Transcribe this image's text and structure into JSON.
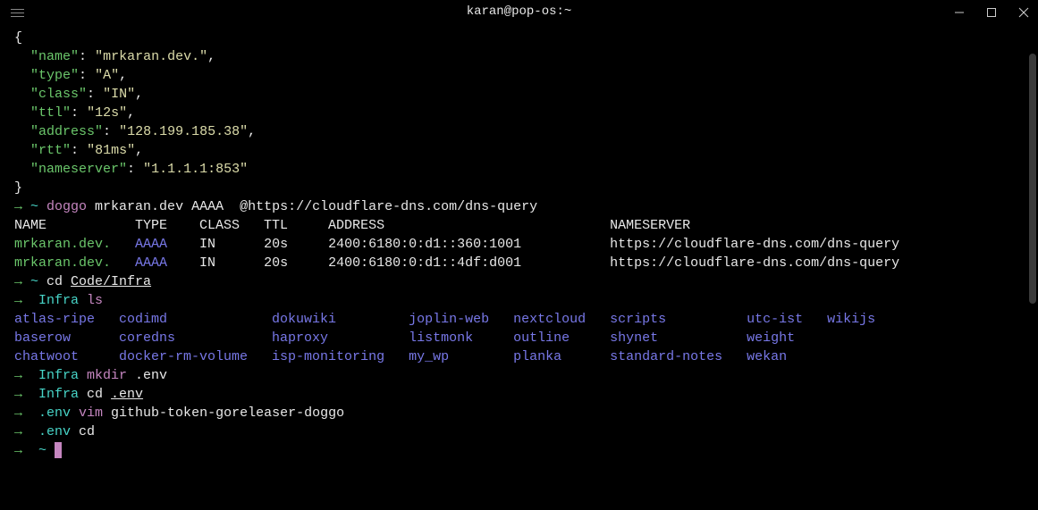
{
  "window": {
    "title": "karan@pop-os:~"
  },
  "json_output": {
    "open_brace": "{",
    "close_brace": "}",
    "fields": [
      {
        "key": "\"name\"",
        "colon": ":",
        "space": " ",
        "value": "\"mrkaran.dev.\"",
        "comma": ","
      },
      {
        "key": "\"type\"",
        "colon": ":",
        "space": " ",
        "value": "\"A\"",
        "comma": ","
      },
      {
        "key": "\"class\"",
        "colon": ":",
        "space": " ",
        "value": "\"IN\"",
        "comma": ","
      },
      {
        "key": "\"ttl\"",
        "colon": ":",
        "space": " ",
        "value": "\"12s\"",
        "comma": ","
      },
      {
        "key": "\"address\"",
        "colon": ":",
        "space": " ",
        "value": "\"128.199.185.38\"",
        "comma": ","
      },
      {
        "key": "\"rtt\"",
        "colon": ":",
        "space": " ",
        "value": "\"81ms\"",
        "comma": ","
      },
      {
        "key": "\"nameserver\"",
        "colon": ":",
        "space": " ",
        "value": "\"1.1.1.1:853\"",
        "comma": ""
      }
    ]
  },
  "doggo_cmd": {
    "arrow": "→",
    "tilde": " ~",
    "cmd": " doggo",
    "args": " mrkaran.dev AAAA  @https://cloudflare-dns.com/dns-query"
  },
  "table": {
    "header": "NAME           TYPE    CLASS   TTL     ADDRESS                            NAMESERVER                           ",
    "rows": [
      {
        "name": "mrkaran.dev.",
        "type": "   AAAA",
        "rest": "    IN      20s     2400:6180:0:d1::360:1001           https://cloudflare-dns.com/dns-query"
      },
      {
        "name": "mrkaran.dev.",
        "type": "   AAAA",
        "rest": "    IN      20s     2400:6180:0:d1::4df:d001           https://cloudflare-dns.com/dns-query"
      }
    ]
  },
  "cd_cmd": {
    "arrow": "→",
    "tilde": " ~",
    "cd": " cd ",
    "path": "Code/Infra"
  },
  "ls_cmd": {
    "arrow": "→ ",
    "dir": " Infra",
    "cmd": " ls"
  },
  "ls_output": {
    "row1": "atlas-ripe   codimd             dokuwiki         joplin-web   nextcloud   scripts          utc-ist   wikijs",
    "row2": "baserow      coredns            haproxy          listmonk     outline     shynet           weight",
    "row3": "chatwoot     docker-rm-volume   isp-monitoring   my_wp        planka      standard-notes   wekan"
  },
  "mkdir_cmd": {
    "arrow": "→ ",
    "dir": " Infra",
    "cmd": " mkdir",
    "args": " .env"
  },
  "cd_env_cmd": {
    "arrow": "→ ",
    "dir": " Infra",
    "cmd": " cd ",
    "args": ".env"
  },
  "vim_cmd": {
    "arrow": "→ ",
    "dir": " .env",
    "cmd": " vim",
    "args": " github-token-goreleaser-doggo"
  },
  "cd_back_cmd": {
    "arrow": "→ ",
    "dir": " .env",
    "cmd": " cd"
  },
  "final_prompt": {
    "arrow": "→ ",
    "tilde": " ~ "
  }
}
